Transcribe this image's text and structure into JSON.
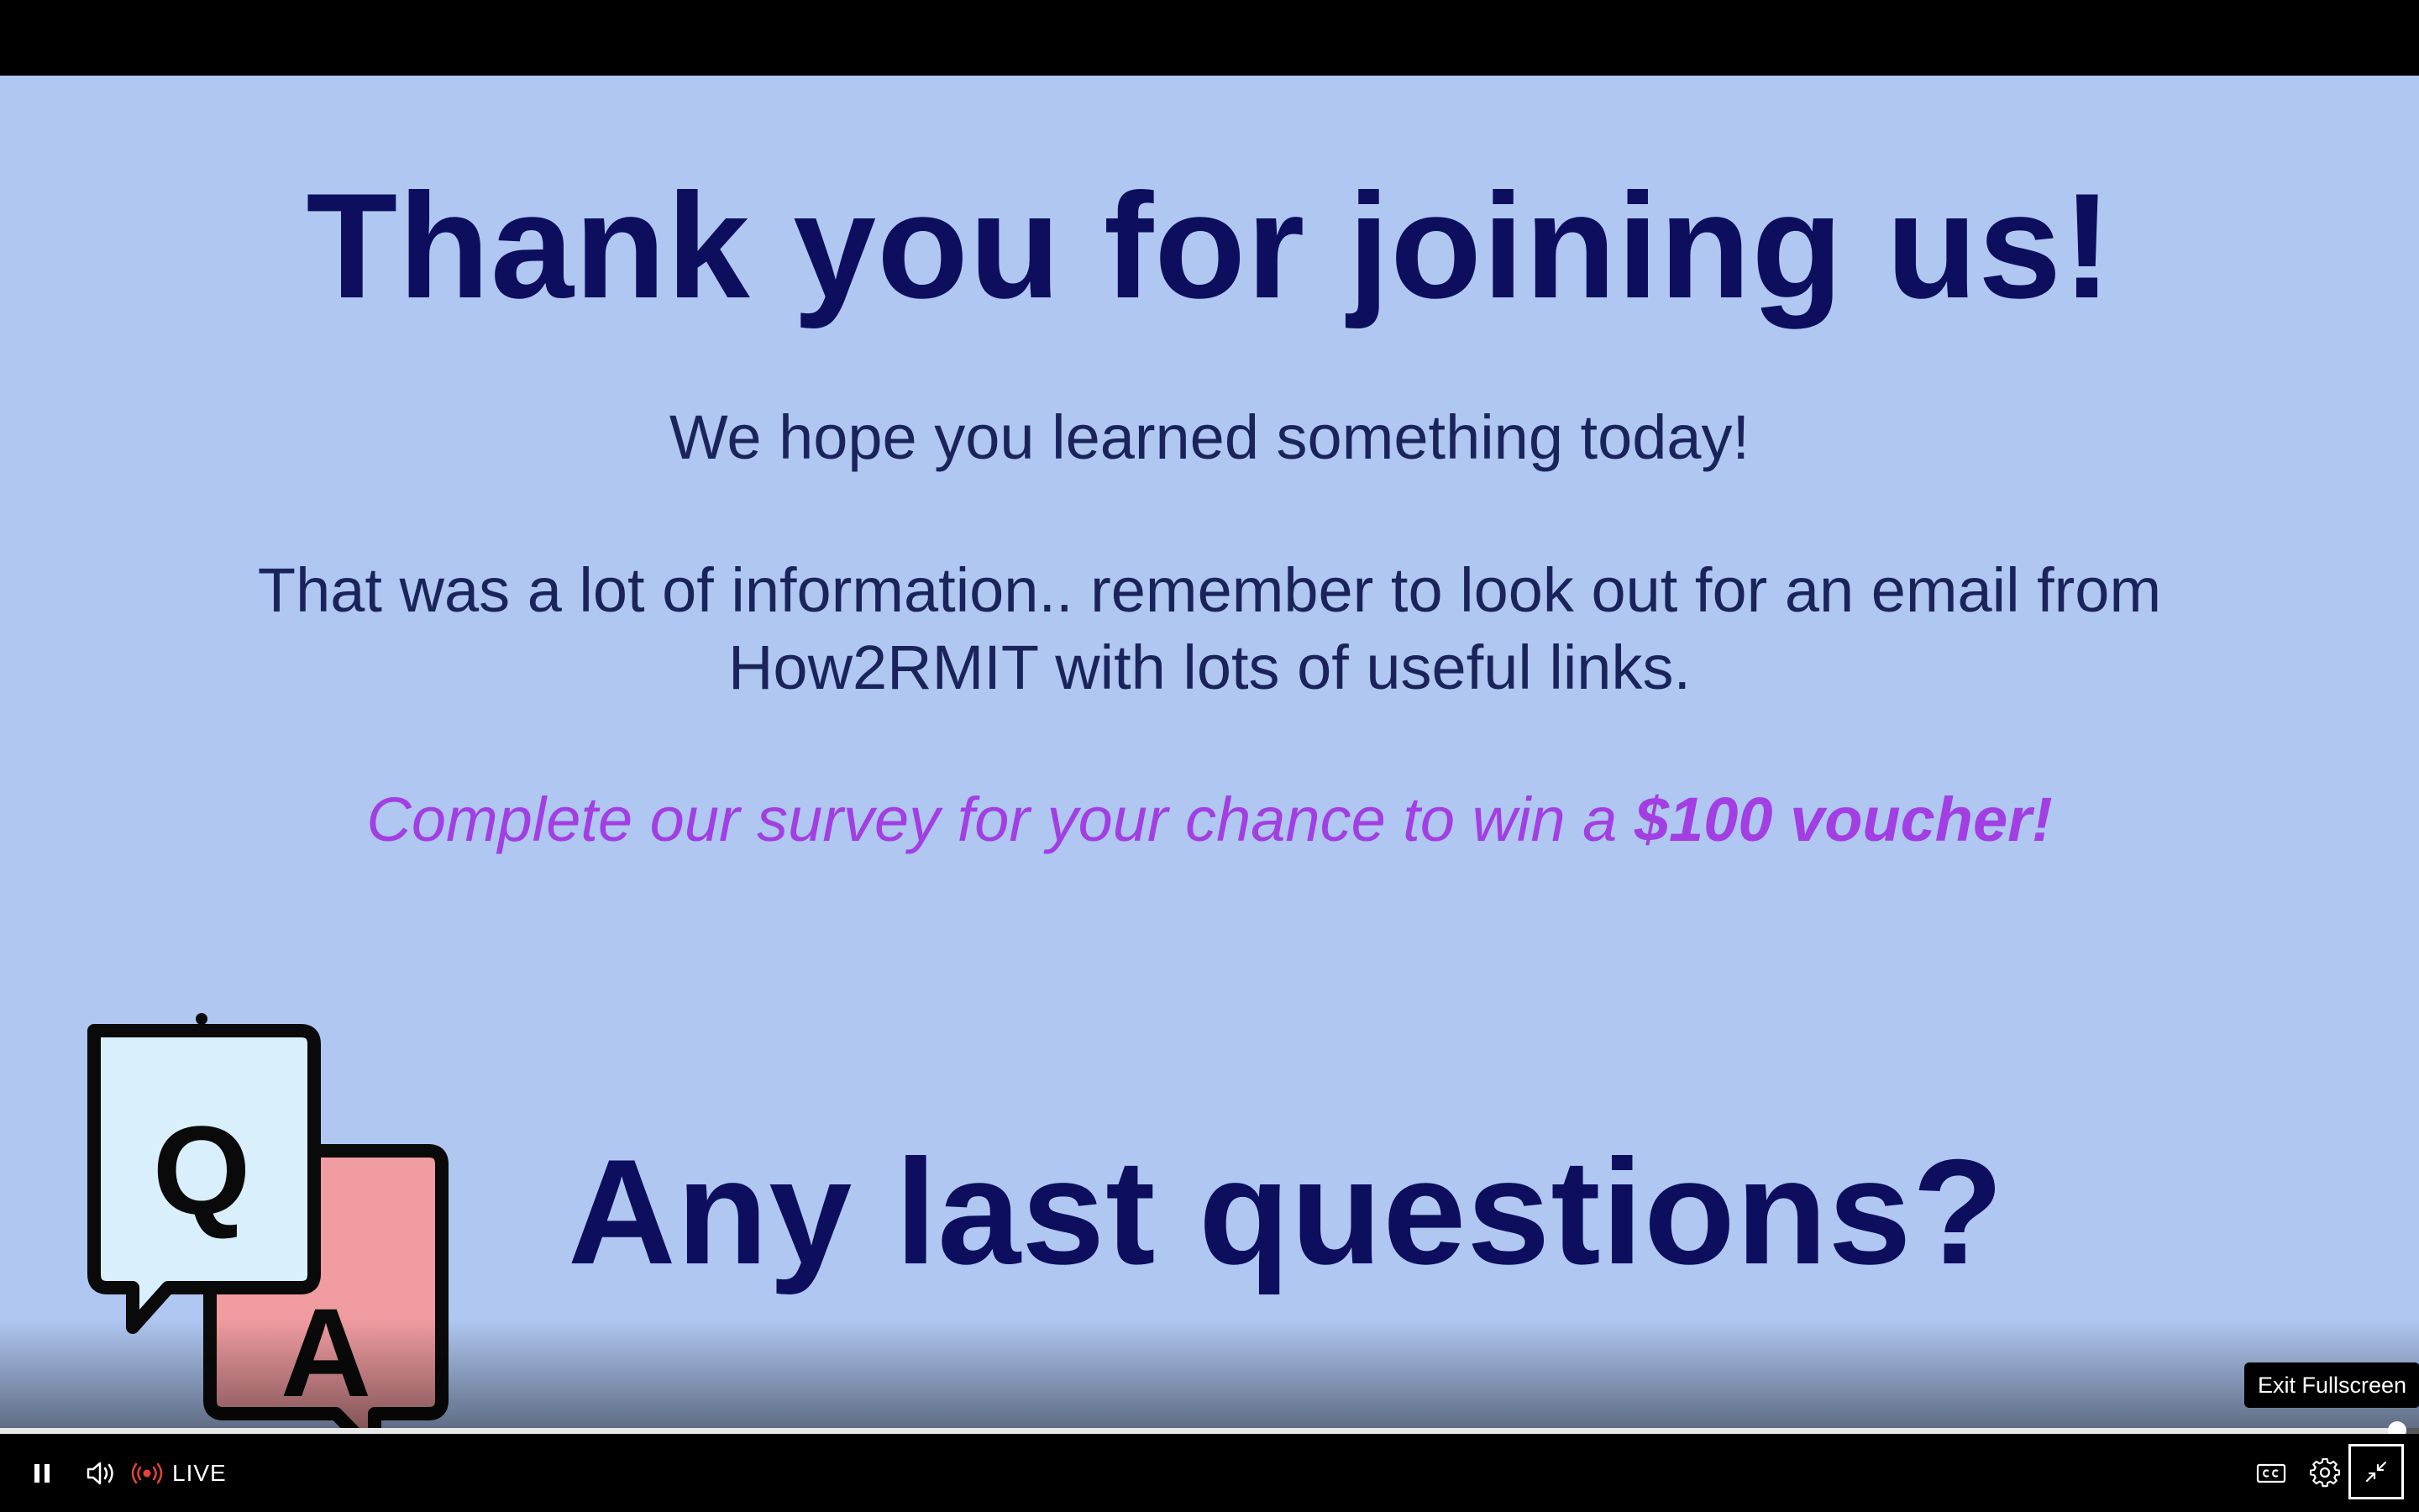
{
  "slide": {
    "title": "Thank you for joining us!",
    "hope_line": "We hope you learned something today!",
    "info_line_1": "That was a lot of information.. remember to look out for an email from",
    "info_line_2": "How2RMIT with lots of useful links.",
    "survey_text": "Complete our survey for your chance to win a ",
    "survey_prize": "$100 voucher!",
    "qa_letters": {
      "q": "Q",
      "a": "A"
    },
    "questions_heading": "Any last questions?",
    "colors": {
      "background": "#afc7f1",
      "heading": "#0d0f5e",
      "body": "#1b245a",
      "survey": "#a23ee2",
      "q_bubble": "#d9effb",
      "a_bubble": "#f09ca1"
    }
  },
  "player": {
    "progress": 0.99,
    "live_label": "LIVE",
    "tooltip": "Exit Fullscreen",
    "icons": {
      "pause": "pause-icon",
      "volume": "volume-icon",
      "live": "live-broadcast-icon",
      "cc": "closed-captions-icon",
      "settings": "gear-icon",
      "exit_fullscreen": "exit-fullscreen-icon"
    },
    "colors": {
      "live_dot": "#e8413a",
      "controls_bg": "#000000"
    }
  }
}
